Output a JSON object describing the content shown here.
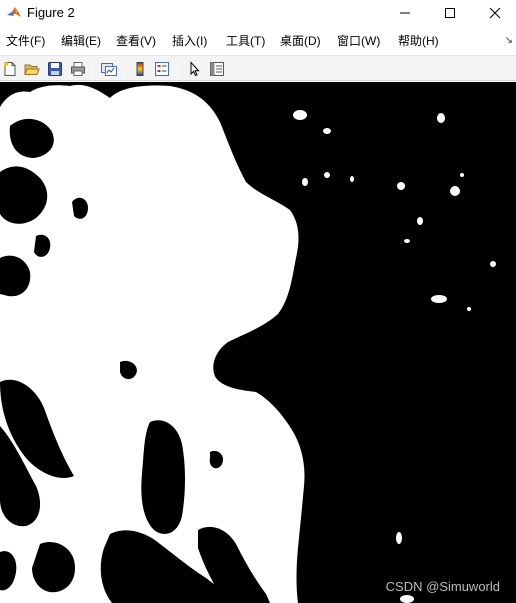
{
  "window": {
    "title": "Figure 2",
    "controls": {
      "minimize": "minimize-icon",
      "maximize": "maximize-icon",
      "close": "close-icon"
    }
  },
  "menu": {
    "items": [
      {
        "label": "文件(F)"
      },
      {
        "label": "编辑(E)"
      },
      {
        "label": "查看(V)"
      },
      {
        "label": "插入(I)"
      },
      {
        "label": "工具(T)"
      },
      {
        "label": "桌面(D)"
      },
      {
        "label": "窗口(W)"
      },
      {
        "label": "帮助(H)"
      }
    ],
    "overflow_icon": "menu-collapse-arrow-icon"
  },
  "toolbar": {
    "buttons": [
      {
        "icon": "new-figure-icon"
      },
      {
        "icon": "open-file-icon"
      },
      {
        "icon": "save-icon"
      },
      {
        "icon": "print-icon"
      },
      {
        "icon": "link-plot-icon"
      },
      {
        "icon": "insert-colorbar-icon"
      },
      {
        "icon": "insert-legend-icon"
      },
      {
        "icon": "pointer-icon"
      },
      {
        "icon": "property-inspector-icon"
      }
    ]
  },
  "figure": {
    "content": "binary-image",
    "foreground_color": "#ffffff",
    "background_color": "#000000"
  },
  "watermark": "CSDN @Simuworld"
}
